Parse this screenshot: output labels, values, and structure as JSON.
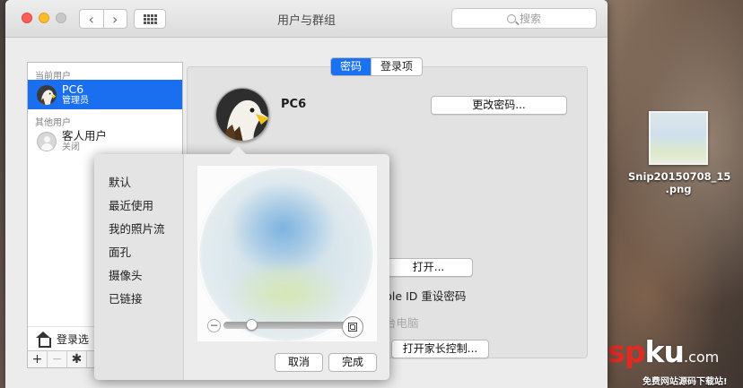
{
  "window": {
    "title": "用户与群组",
    "search_placeholder": "搜索"
  },
  "sidebar": {
    "current_header": "当前用户",
    "current_user": {
      "name": "PC6",
      "role": "管理员"
    },
    "other_header": "其他用户",
    "guest_user": {
      "name": "客人用户",
      "status": "关闭"
    },
    "login_options": "登录选",
    "toolbar": {
      "add": "+",
      "remove": "−",
      "gear": "✱"
    }
  },
  "tabs": [
    {
      "label": "密码",
      "active": true
    },
    {
      "label": "登录项",
      "active": false
    }
  ],
  "main": {
    "user_name": "PC6",
    "change_password_button": "更改密码...",
    "open_button": "打开...",
    "apple_id_text": "ple ID 重设密码",
    "computer_text": "台电脑",
    "parental_controls_button": "打开家长控制..."
  },
  "popover": {
    "categories": [
      "默认",
      "最近使用",
      "我的照片流",
      "面孔",
      "摄像头",
      "已链接"
    ],
    "zoom_minus": "−",
    "zoom_plus": "+",
    "zoom_level": 0.2,
    "cancel_button": "取消",
    "done_button": "完成"
  },
  "desktop": {
    "file_name_line1": "Snip20150708_15",
    "file_name_line2": ".png",
    "watermark_red": "asp",
    "watermark_white": "ku",
    "watermark_suffix": ".com",
    "watermark_sub": "免费网站源码下载站!"
  }
}
